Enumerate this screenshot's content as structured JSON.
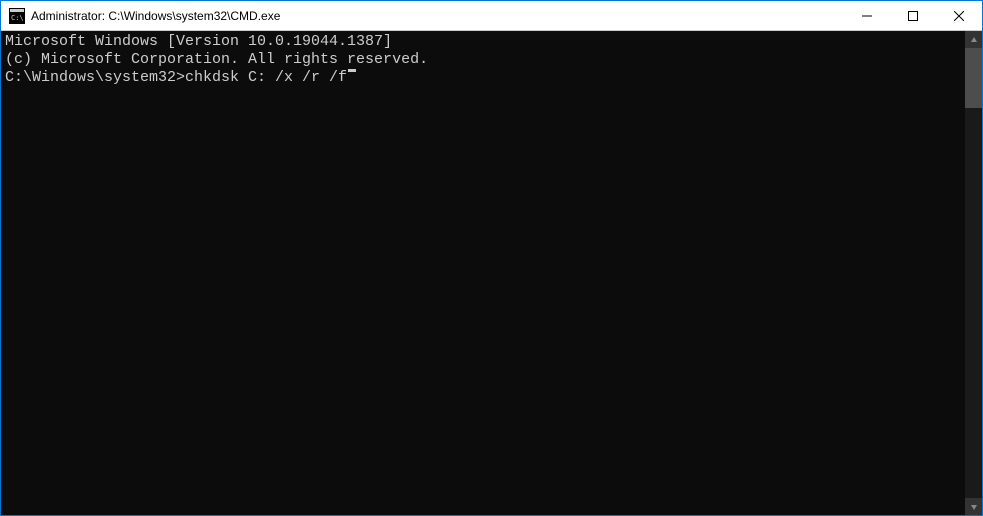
{
  "titlebar": {
    "title": "Administrator: C:\\Windows\\system32\\CMD.exe"
  },
  "console": {
    "line1": "Microsoft Windows [Version 10.0.19044.1387]",
    "line2": "(c) Microsoft Corporation. All rights reserved.",
    "blank": "",
    "prompt": "C:\\Windows\\system32>",
    "command": "chkdsk C: /x /r /f"
  }
}
